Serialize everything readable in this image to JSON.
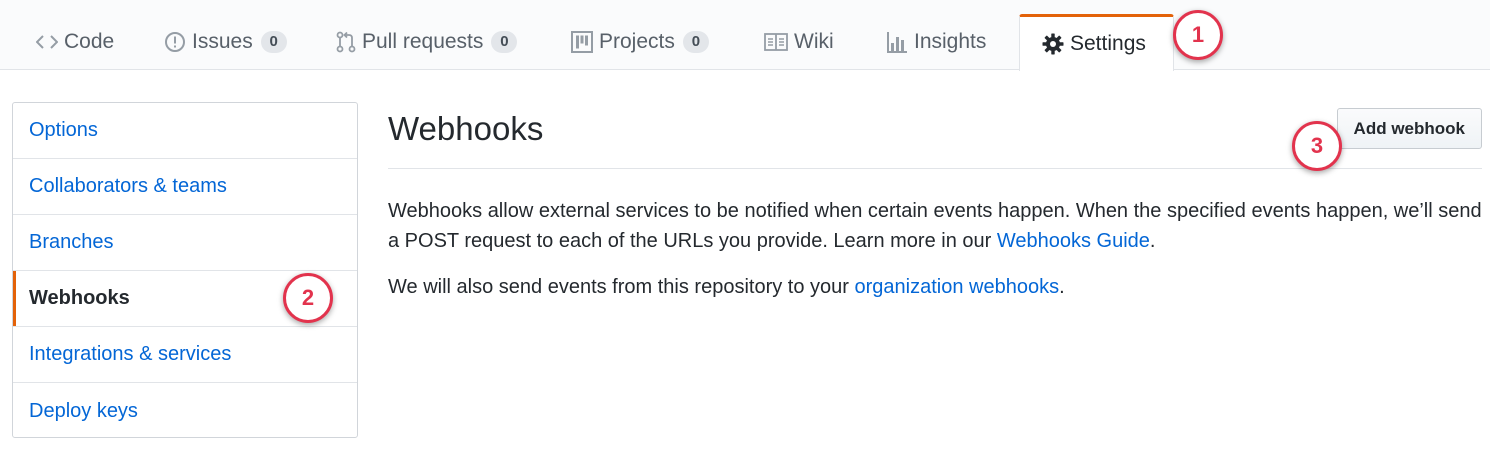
{
  "tabs": [
    {
      "label": "Code",
      "icon": "code-icon"
    },
    {
      "label": "Issues",
      "icon": "issue-icon",
      "count": "0"
    },
    {
      "label": "Pull requests",
      "icon": "pull-request-icon",
      "count": "0"
    },
    {
      "label": "Projects",
      "icon": "project-icon",
      "count": "0"
    },
    {
      "label": "Wiki",
      "icon": "book-icon"
    },
    {
      "label": "Insights",
      "icon": "graph-icon"
    },
    {
      "label": "Settings",
      "icon": "gear-icon",
      "selected": true
    }
  ],
  "sidebar": {
    "items": [
      {
        "label": "Options"
      },
      {
        "label": "Collaborators & teams"
      },
      {
        "label": "Branches"
      },
      {
        "label": "Webhooks",
        "selected": true
      },
      {
        "label": "Integrations & services"
      },
      {
        "label": "Deploy keys"
      }
    ]
  },
  "main": {
    "title": "Webhooks",
    "add_button": "Add webhook",
    "description": {
      "text": "Webhooks allow external services to be notified when certain events happen. When the specified events happen, we’ll send a POST request to each of the URLs you provide. Learn more in our ",
      "link": "Webhooks Guide",
      "end": "."
    },
    "org_note": {
      "text": "We will also send events from this repository to your ",
      "link": "organization webhooks",
      "end": "."
    }
  },
  "annotations": [
    "1",
    "2",
    "3"
  ],
  "colors": {
    "accent": "#e36209",
    "link": "#0366d6",
    "annotation": "#e2334d",
    "text": "#24292e"
  }
}
